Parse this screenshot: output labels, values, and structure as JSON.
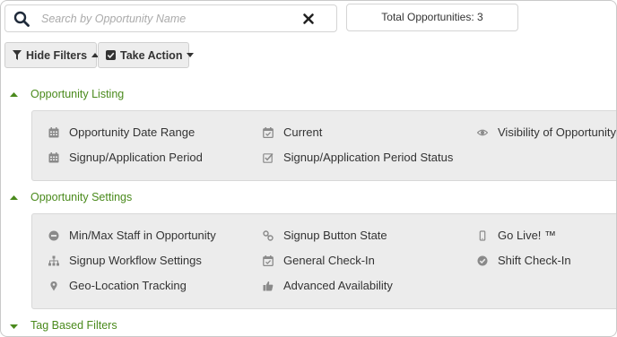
{
  "search": {
    "placeholder": "Search by Opportunity Name"
  },
  "total": {
    "label": "Total Opportunities: 3"
  },
  "toolbar": {
    "hide_filters_label": "Hide Filters",
    "take_action_label": "Take Action"
  },
  "colors": {
    "section_title": "#4a8a1c",
    "panel_bg": "#ececec",
    "icon": "#8a8a8a"
  },
  "sections": [
    {
      "title": "Opportunity Listing",
      "expanded": true,
      "items": [
        {
          "label": "Opportunity Date Range",
          "icon": "calendar-icon"
        },
        {
          "label": "Current",
          "icon": "calendar-check-icon"
        },
        {
          "label": "Visibility of Opportunity",
          "icon": "eye-icon"
        },
        {
          "label": "Signup/Application Period",
          "icon": "calendar-icon"
        },
        {
          "label": "Signup/Application Period Status",
          "icon": "checkbox-icon"
        }
      ]
    },
    {
      "title": "Opportunity Settings",
      "expanded": true,
      "items": [
        {
          "label": "Min/Max Staff in Opportunity",
          "icon": "minus-circle-icon"
        },
        {
          "label": "Signup Button State",
          "icon": "link-icon"
        },
        {
          "label": "Go Live! ™",
          "icon": "mobile-icon"
        },
        {
          "label": "Signup Workflow Settings",
          "icon": "sitemap-icon"
        },
        {
          "label": "General Check-In",
          "icon": "calendar-check-icon"
        },
        {
          "label": "Shift Check-In",
          "icon": "check-circle-icon"
        },
        {
          "label": "Geo-Location Tracking",
          "icon": "map-marker-icon"
        },
        {
          "label": "Advanced Availability",
          "icon": "thumbs-up-icon"
        }
      ]
    },
    {
      "title": "Tag Based Filters",
      "expanded": false,
      "items": []
    }
  ]
}
